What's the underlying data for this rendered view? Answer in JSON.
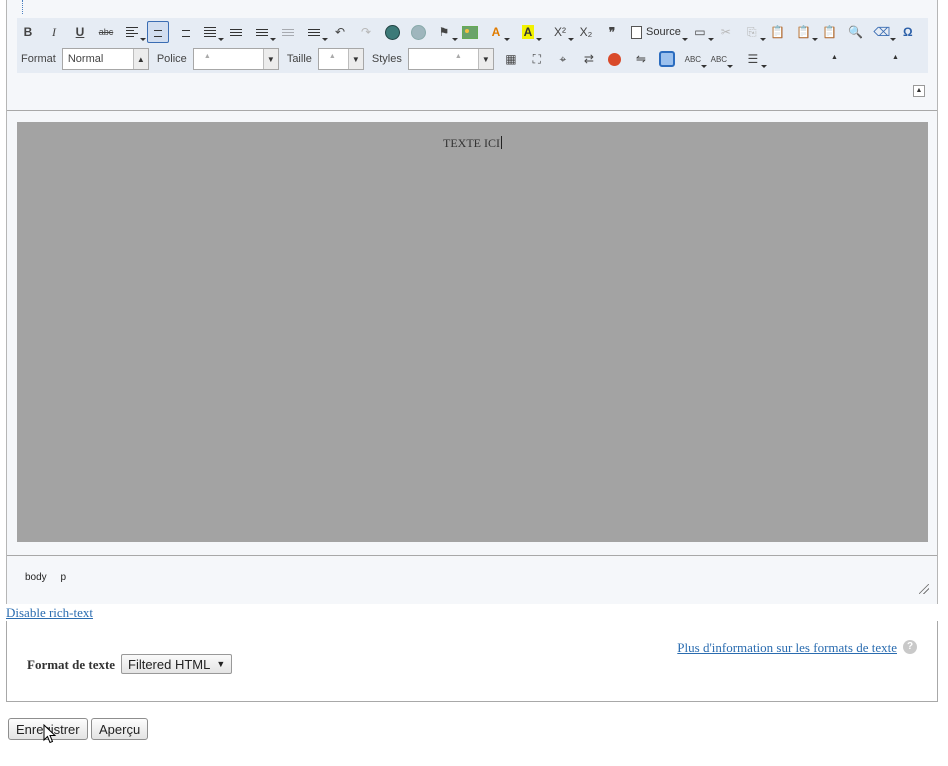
{
  "toolbar": {
    "row1": {
      "bold": "B",
      "italic": "I",
      "underline": "U",
      "strike": "abc",
      "superscript": "X²",
      "subscript": "X₂",
      "blockquote": "❞",
      "source": "Source",
      "special_char": "Ω"
    },
    "row2": {
      "format_label": "Format",
      "format_value": "Normal",
      "font_label": "Police",
      "size_label": "Taille",
      "styles_label": "Styles",
      "spell1": "ABC",
      "spell2": "ABC"
    }
  },
  "content": {
    "text": "TEXTE ICI"
  },
  "status_bar": {
    "path": [
      "body",
      "p"
    ]
  },
  "disable_rich_text": "Disable rich-text",
  "text_format": {
    "more_info_link": "Plus d'information sur les formats de texte",
    "help_icon": "?",
    "label": "Format de texte",
    "selected": "Filtered HTML",
    "dropdown_glyph": "▼"
  },
  "actions": {
    "save": "Enregistrer",
    "preview": "Aperçu"
  }
}
